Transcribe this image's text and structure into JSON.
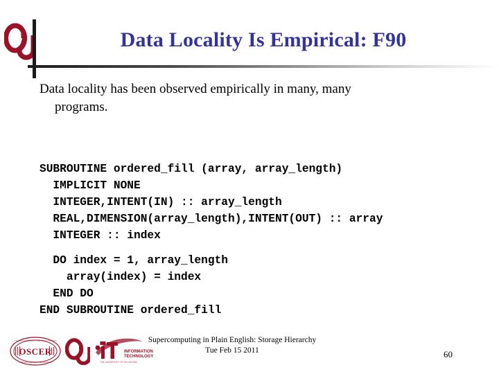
{
  "slide": {
    "title": "Data Locality Is Empirical: F90",
    "title_color": "#333399",
    "background_color": "#ffffff"
  },
  "header": {
    "ou_logo_name": "ou-logo",
    "ou_logo_color": "#9B1127",
    "divider_color": "#1a1a1a"
  },
  "body": {
    "line1": "Data locality has been observed empirically in many, many",
    "line2": "programs."
  },
  "code": {
    "language": "Fortran 90",
    "lines": [
      "SUBROUTINE ordered_fill (array, array_length)",
      "  IMPLICIT NONE",
      "  INTEGER,INTENT(IN) :: array_length",
      "  REAL,DIMENSION(array_length),INTENT(OUT) :: array",
      "  INTEGER :: index",
      "",
      "  DO index = 1, array_length",
      "    array(index) = index",
      "  END DO",
      "END SUBROUTINE ordered_fill"
    ]
  },
  "footer": {
    "title_line": "Supercomputing in Plain English: Storage Hierarchy",
    "date_line": "Tue Feb 15 2011",
    "page_number": "60",
    "logos": [
      {
        "name": "oscer-logo",
        "text": "OSCER"
      },
      {
        "name": "ou-logo",
        "text": "OU"
      },
      {
        "name": "ou-it-logo",
        "text_primary": "it",
        "text_secondary": "INFORMATION TECHNOLOGY",
        "text_tertiary": "THE UNIVERSITY OF OKLAHOMA"
      }
    ]
  }
}
